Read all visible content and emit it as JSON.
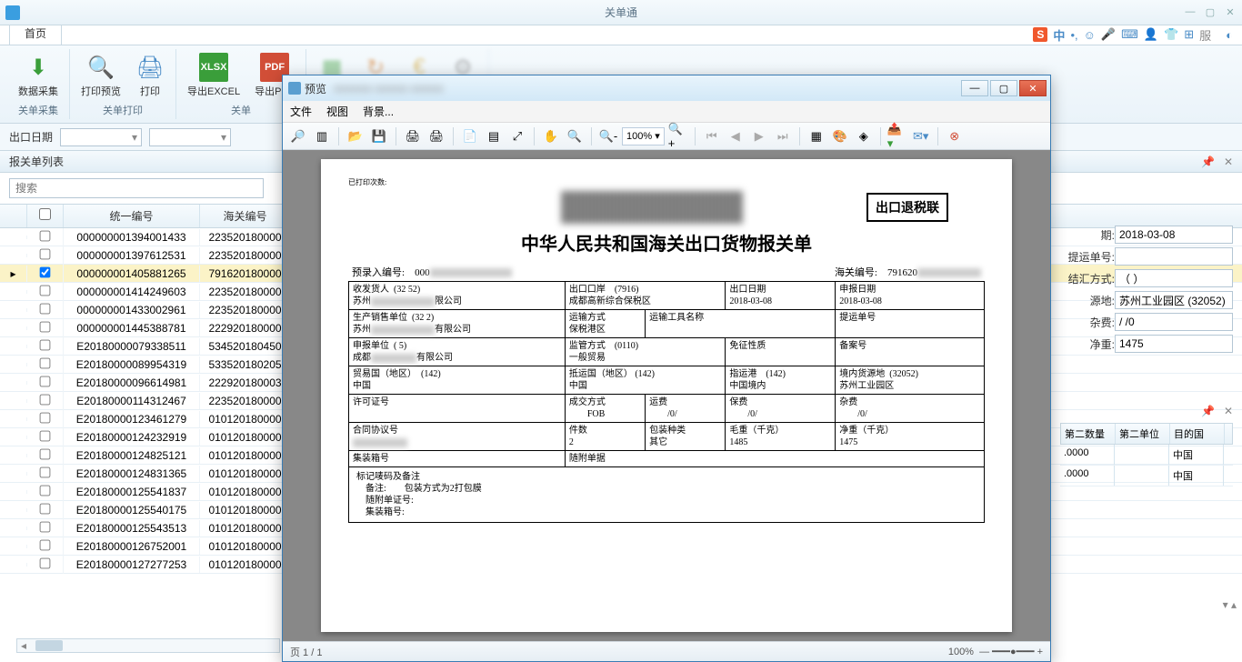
{
  "app": {
    "title": "关单通"
  },
  "tabs": {
    "home": "首页"
  },
  "ribbon": {
    "group1": {
      "label": "关单采集",
      "btn1": "数据采集"
    },
    "group2": {
      "label": "关单打印",
      "btn1": "打印预览",
      "btn2": "打印"
    },
    "group3": {
      "label": "关单",
      "btn1": "导出EXCEL",
      "btn2": "导出PDF"
    }
  },
  "filter": {
    "export_date_label": "出口日期"
  },
  "list": {
    "panel_title": "报关单列表",
    "search_placeholder": "搜索",
    "col_id": "统一编号",
    "col_customs": "海关编号",
    "rows": [
      {
        "id": "000000001394001433",
        "c": "223520180000",
        "sel": false
      },
      {
        "id": "000000001397612531",
        "c": "223520180000",
        "sel": false
      },
      {
        "id": "000000001405881265",
        "c": "791620180000",
        "sel": true
      },
      {
        "id": "000000001414249603",
        "c": "223520180000",
        "sel": false
      },
      {
        "id": "000000001433002961",
        "c": "223520180000",
        "sel": false
      },
      {
        "id": "000000001445388781",
        "c": "222920180000",
        "sel": false
      },
      {
        "id": "E20180000079338511",
        "c": "534520180450",
        "sel": false
      },
      {
        "id": "E20180000089954319",
        "c": "533520180205",
        "sel": false
      },
      {
        "id": "E20180000096614981",
        "c": "222920180003",
        "sel": false
      },
      {
        "id": "E20180000114312467",
        "c": "223520180000",
        "sel": false
      },
      {
        "id": "E20180000123461279",
        "c": "010120180000",
        "sel": false
      },
      {
        "id": "E20180000124232919",
        "c": "010120180000",
        "sel": false
      },
      {
        "id": "E20180000124825121",
        "c": "010120180000",
        "sel": false
      },
      {
        "id": "E20180000124831365",
        "c": "010120180000",
        "sel": false
      },
      {
        "id": "E20180000125541837",
        "c": "010120180000",
        "sel": false
      },
      {
        "id": "E20180000125540175",
        "c": "010120180000",
        "sel": false
      },
      {
        "id": "E20180000125543513",
        "c": "010120180000",
        "sel": false
      },
      {
        "id": "E20180000126752001",
        "c": "010120180000",
        "sel": false
      },
      {
        "id": "E20180000127277253",
        "c": "010120180000",
        "sel": false
      }
    ]
  },
  "right": {
    "date_lbl": "期:",
    "date_val": "2018-03-08",
    "bl_lbl": "提运单号:",
    "bl_val": "",
    "settle_lbl": "结汇方式:",
    "settle_val": "（ ）",
    "origin_lbl": "源地:",
    "origin_val": "苏州工业园区 (32052)",
    "misc_lbl": "杂费:",
    "misc_val": "/  /0",
    "net_lbl": "净重:",
    "net_val": "1475",
    "grid": {
      "h1": "第二数量",
      "h2": "第二单位",
      "h3": "目的国",
      "v1": ".0000",
      "v3": "中国"
    }
  },
  "preview": {
    "title": "预览",
    "menu": {
      "file": "文件",
      "view": "视图",
      "bg": "背景..."
    },
    "zoom": "100%",
    "status_page": "页 1 / 1",
    "status_zoom": "100%",
    "doc": {
      "print_count": "已打印次数:",
      "tag": "出口退税联",
      "title": "中华人民共和国海关出口货物报关单",
      "pre_label": "预录入编号:",
      "pre_val": "000",
      "customs_no_label": "海关编号:",
      "customs_no_val": "791620",
      "consignor_lbl": "收发货人",
      "consignor_code": "(32            52)",
      "consignor_val1": "苏州",
      "consignor_val2": "限公司",
      "port_lbl": "出口口岸",
      "port_code": "(7916)",
      "port_val": "成都高新综合保税区",
      "export_date_lbl": "出口日期",
      "export_date_val": "2018-03-08",
      "declare_date_lbl": "申报日期",
      "declare_date_val": "2018-03-08",
      "producer_lbl": "生产销售单位",
      "producer_code": "(32           2)",
      "producer_val1": "苏州",
      "producer_val2": "有限公司",
      "transport_mode_lbl": "运输方式",
      "transport_mode_val": "保税港区",
      "transport_tool_lbl": "运输工具名称",
      "bl_no_lbl": "提运单号",
      "declarer_lbl": "申报单位",
      "declarer_code": "(             5)",
      "declarer_val1": "成都",
      "declarer_val2": "有限公司",
      "supervise_lbl": "监管方式",
      "supervise_code": "(0110)",
      "supervise_val": "一般贸易",
      "exempt_lbl": "免征性质",
      "record_no_lbl": "备案号",
      "trade_country_lbl": "贸易国（地区）",
      "trade_country_code": "(142)",
      "trade_country_val": "中国",
      "dest_country_lbl": "抵运国（地区）",
      "dest_country_code": "(142)",
      "dest_country_val": "中国",
      "dest_port_lbl": "指运港",
      "dest_port_code": "(142)",
      "dest_port_val": "中国境内",
      "domestic_src_lbl": "境内货源地",
      "domestic_src_code": "(32052)",
      "domestic_src_val": "苏州工业园区",
      "license_lbl": "许可证号",
      "deal_lbl": "成交方式",
      "deal_val": "FOB",
      "freight_lbl": "运费",
      "freight_val": "/0/",
      "insurance_lbl": "保费",
      "insurance_val": "/0/",
      "misc_fee_lbl": "杂费",
      "misc_fee_val": "/0/",
      "contract_lbl": "合同协议号",
      "pieces_lbl": "件数",
      "pieces_val": "2",
      "pack_lbl": "包装种类",
      "pack_val": "其它",
      "gross_lbl": "毛重（千克）",
      "gross_val": "1485",
      "net_lbl": "净重（千克）",
      "net_val": "1475",
      "container_lbl": "集装箱号",
      "attach_lbl": "随附单据",
      "marks_lbl": "标记唛码及备注",
      "remark_lbl": "备注:",
      "remark_val": "包装方式为2打包膜",
      "attach_cert_lbl": "随附单证号:",
      "container_no_lbl": "集装箱号:"
    }
  },
  "ime": {
    "zhong": "中"
  }
}
